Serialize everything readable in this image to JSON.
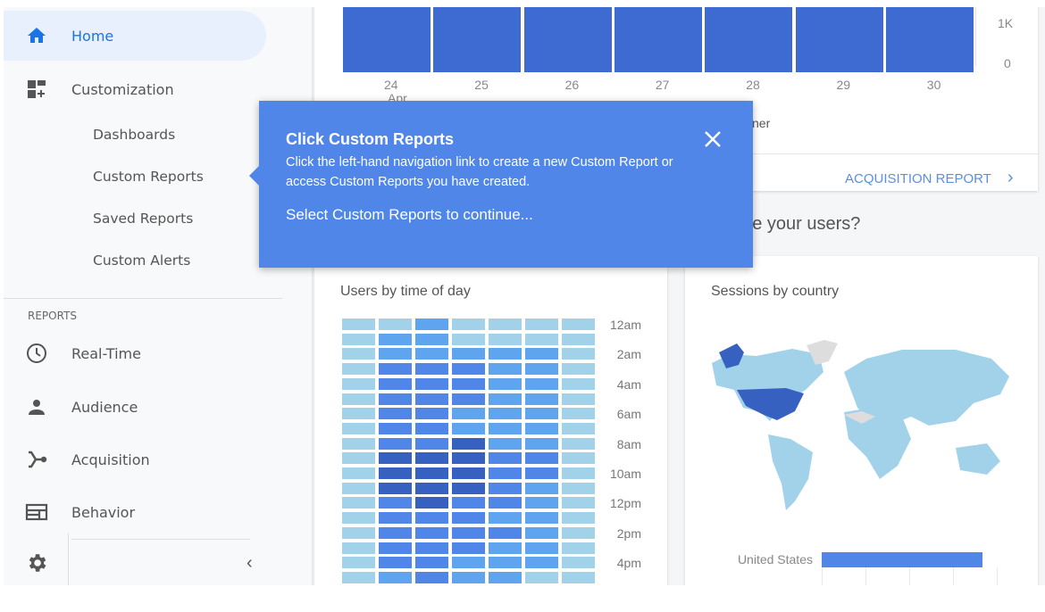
{
  "sidebar": {
    "home": "Home",
    "customization": "Customization",
    "sub_items": [
      "Dashboards",
      "Custom Reports",
      "Saved Reports",
      "Custom Alerts"
    ],
    "reports_header": "REPORTS",
    "reports": [
      "Real-Time",
      "Audience",
      "Acquisition",
      "Behavior"
    ],
    "accent": "#1a73e8"
  },
  "top_chart": {
    "chart_data": {
      "type": "bar",
      "categories": [
        "24",
        "25",
        "26",
        "27",
        "28",
        "29",
        "30"
      ],
      "x_sublabel": "Apr",
      "ytick_labels": [
        "0",
        "1K"
      ],
      "color": "#3d6bd1"
    },
    "partial_label": "ner",
    "link": "ACQUISITION REPORT"
  },
  "section_heading": "Where are your users?",
  "time_card": {
    "title": "Users by time of day",
    "chart_data": {
      "type": "heatmap",
      "row_labels": [
        "12am",
        "2am",
        "4am",
        "6am",
        "8am",
        "10am",
        "12pm",
        "2pm",
        "4pm"
      ],
      "levels": [
        [
          0,
          0,
          1,
          0,
          0,
          0,
          0
        ],
        [
          0,
          1,
          1,
          0,
          0,
          0,
          0
        ],
        [
          0,
          1,
          1,
          1,
          1,
          1,
          0
        ],
        [
          0,
          2,
          2,
          2,
          1,
          1,
          0
        ],
        [
          0,
          2,
          2,
          2,
          1,
          1,
          0
        ],
        [
          0,
          2,
          2,
          2,
          1,
          1,
          0
        ],
        [
          0,
          2,
          2,
          1,
          1,
          1,
          0
        ],
        [
          0,
          2,
          2,
          1,
          1,
          1,
          0
        ],
        [
          0,
          2,
          2,
          3,
          1,
          1,
          0
        ],
        [
          0,
          3,
          3,
          3,
          2,
          2,
          0
        ],
        [
          0,
          3,
          3,
          3,
          2,
          2,
          0
        ],
        [
          0,
          3,
          3,
          3,
          2,
          1,
          0
        ],
        [
          0,
          2,
          3,
          2,
          2,
          1,
          0
        ],
        [
          0,
          2,
          2,
          2,
          1,
          1,
          0
        ],
        [
          0,
          2,
          2,
          2,
          2,
          1,
          0
        ],
        [
          0,
          2,
          2,
          2,
          1,
          1,
          0
        ],
        [
          0,
          2,
          2,
          1,
          1,
          1,
          0
        ],
        [
          0,
          1,
          2,
          1,
          1,
          0,
          0
        ]
      ],
      "colors": [
        "#a2d2ea",
        "#5ea4ee",
        "#4f86e8",
        "#3761c0"
      ]
    }
  },
  "country_card": {
    "title": "Sessions by country",
    "bar_label": "United States",
    "highlight": "#3761c0",
    "map_color": "#a2d2ea"
  },
  "popup": {
    "title": "Click Custom Reports",
    "body": "Click the left-hand navigation link to create a new Custom Report or access Custom Reports you have created.",
    "cta": "Select Custom Reports to continue..."
  }
}
